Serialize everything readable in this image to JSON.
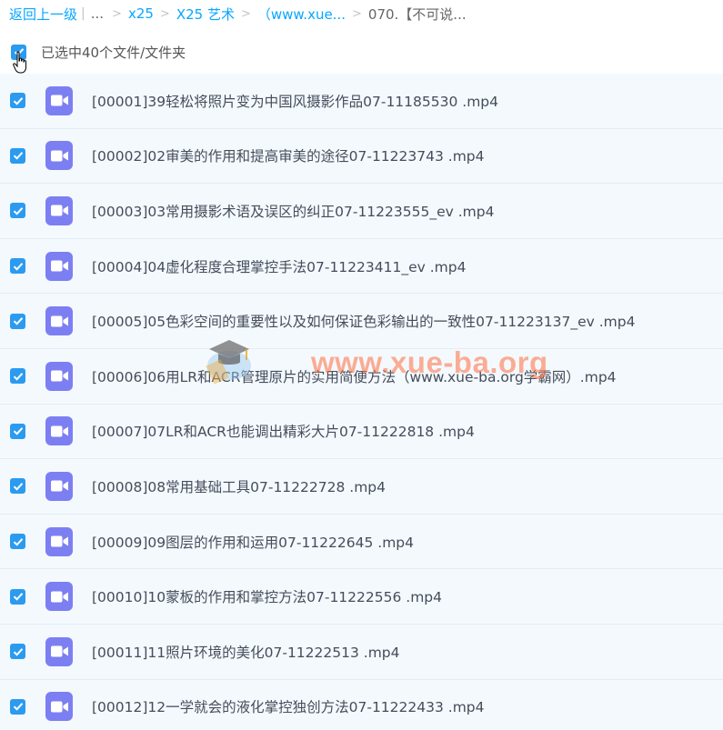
{
  "breadcrumb": {
    "back_label": "返回上一级",
    "ellipsis": "...",
    "items": [
      "x25",
      "X25 艺术",
      "（www.xue...",
      "070.【不可说..."
    ],
    "separator": ">",
    "divider": "|"
  },
  "selection": {
    "label": "已选中40个文件/文件夹",
    "checked": true
  },
  "files": [
    {
      "name": "[00001]39轻松将照片变为中国风摄影作品07-11185530 .mp4",
      "checked": true
    },
    {
      "name": "[00002]02审美的作用和提高审美的途径07-11223743 .mp4",
      "checked": true
    },
    {
      "name": "[00003]03常用摄影术语及误区的纠正07-11223555_ev .mp4",
      "checked": true
    },
    {
      "name": "[00004]04虚化程度合理掌控手法07-11223411_ev .mp4",
      "checked": true
    },
    {
      "name": "[00005]05色彩空间的重要性以及如何保证色彩输出的一致性07-11223137_ev .mp4",
      "checked": true
    },
    {
      "name": "[00006]06用LR和ACR管理原片的实用简便方法（www.xue-ba.org学霸网）.mp4",
      "checked": true
    },
    {
      "name": "[00007]07LR和ACR也能调出精彩大片07-11222818 .mp4",
      "checked": true
    },
    {
      "name": "[00008]08常用基础工具07-11222728 .mp4",
      "checked": true
    },
    {
      "name": "[00009]09图层的作用和运用07-11222645 .mp4",
      "checked": true
    },
    {
      "name": "[00010]10蒙板的作用和掌控方法07-11222556 .mp4",
      "checked": true
    },
    {
      "name": "[00011]11照片环境的美化07-11222513 .mp4",
      "checked": true
    },
    {
      "name": "[00012]12一学就会的液化掌控独创方法07-11222433 .mp4",
      "checked": true
    }
  ],
  "watermark": {
    "text": "www.xue-ba.org",
    "icon": "graduation-cap-logo"
  },
  "colors": {
    "link": "#06a7ff",
    "checkbox": "#2b9bf0",
    "video_icon": "#7c7ff2",
    "row_bg": "#f4f9fe",
    "watermark": "#ff6e3c"
  },
  "icons": {
    "checkbox": "check-icon",
    "file": "video-file-icon",
    "cursor": "hand-pointer-icon"
  }
}
